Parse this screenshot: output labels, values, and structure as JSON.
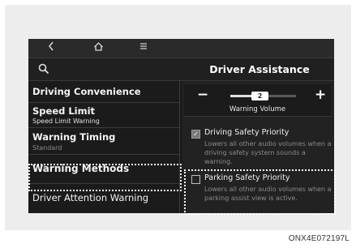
{
  "header": {
    "title": "Driver Assistance"
  },
  "sidebar": {
    "items": [
      {
        "title": "Driving Convenience",
        "sub": ""
      },
      {
        "title": "Speed Limit",
        "sub": "Speed Limit Warning"
      },
      {
        "title": "Warning Timing",
        "sub": "Standard"
      },
      {
        "title": "Warning Methods",
        "sub": ""
      },
      {
        "title": "Driver Attention Warning",
        "sub": ""
      }
    ]
  },
  "volume": {
    "minus": "−",
    "plus": "+",
    "value": "2",
    "label": "Warning Volume"
  },
  "options": [
    {
      "title": "Driving Safety Priority",
      "desc": "Lowers all other audio volumes when a driving safety system sounds a warning.",
      "checked": true
    },
    {
      "title": "Parking Safety Priority",
      "desc": "Lowers all other audio volumes when a parking assist view is active.",
      "checked": false
    }
  ],
  "caption": "ONX4E072197L",
  "icons": {
    "back": "back-chevron-icon",
    "home": "home-icon",
    "menu": "menu-icon",
    "search": "search-icon"
  }
}
